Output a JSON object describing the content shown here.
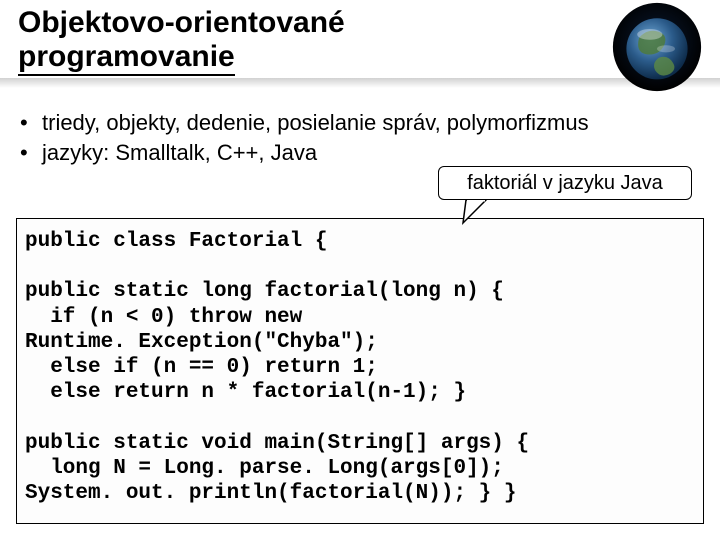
{
  "title_line1": "Objektovo-orientované",
  "title_line2": "programovanie",
  "bullets": [
    "triedy, objekty, dedenie, posielanie správ, polymorfizmus",
    "jazyky: Smalltalk, C++, Java"
  ],
  "callout": "faktoriál v jazyku Java",
  "code": "public class Factorial {\n\npublic static long factorial(long n) {\n  if (n < 0) throw new\nRuntime. Exception(\"Chyba\");\n  else if (n == 0) return 1;\n  else return n * factorial(n-1); }\n\npublic static void main(String[] args) {\n  long N = Long. parse. Long(args[0]);\nSystem. out. println(factorial(N)); } }"
}
